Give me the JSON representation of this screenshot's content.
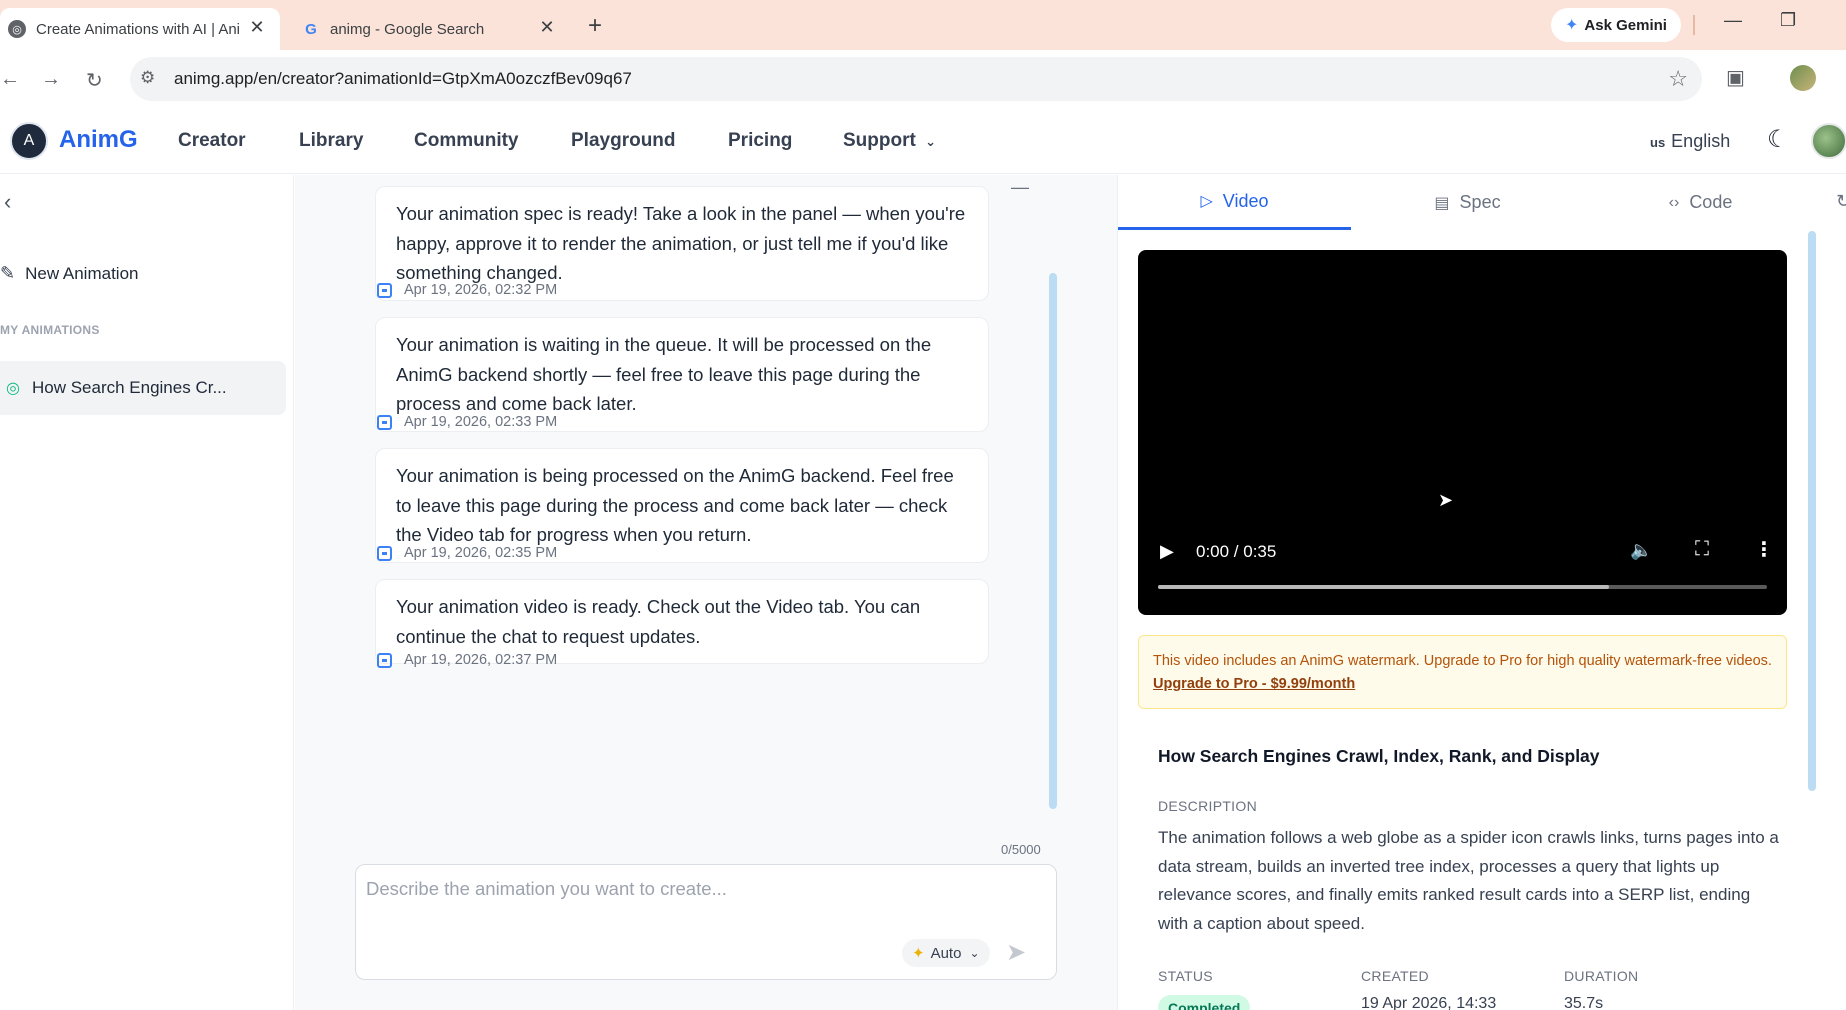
{
  "browser": {
    "tabs": [
      {
        "title": "Create Animations with AI | AnimG",
        "active": true
      },
      {
        "title": "animg - Google Search",
        "active": false
      }
    ],
    "ask_gemini": "Ask Gemini",
    "url": "animg.app/en/creator?animationId=GtpXmA0ozczfBev09q67"
  },
  "header": {
    "logo_letter": "A",
    "brand": "AnimG",
    "nav": [
      "Creator",
      "Library",
      "Community",
      "Playground",
      "Pricing",
      "Support"
    ],
    "lang_code": "us",
    "lang_label": "English"
  },
  "sidebar": {
    "new_animation": "New Animation",
    "section_label": "MY ANIMATIONS",
    "items": [
      {
        "label": "How Search Engines Cr...",
        "status": "completed"
      }
    ]
  },
  "chat": {
    "messages": [
      {
        "text": "Your animation spec is ready! Take a look in the panel — when you're happy, approve it to render the animation, or just tell me if you'd like something changed.",
        "time": "Apr 19, 2026, 02:32 PM"
      },
      {
        "text": "Your animation is waiting in the queue. It will be processed on the AnimG backend shortly — feel free to leave this page during the process and come back later.",
        "time": "Apr 19, 2026, 02:33 PM"
      },
      {
        "text": "Your animation is being processed on the AnimG backend. Feel free to leave this page during the process and come back later — check the Video tab for progress when you return.",
        "time": "Apr 19, 2026, 02:35 PM"
      },
      {
        "text": "Your animation video is ready. Check out the Video tab. You can continue the chat to request updates.",
        "time": "Apr 19, 2026, 02:37 PM"
      }
    ],
    "counter": "0/5000",
    "placeholder": "Describe the animation you want to create...",
    "mode": "Auto"
  },
  "panel": {
    "tabs": [
      "Video",
      "Spec",
      "Code"
    ],
    "active_tab": "Video",
    "video": {
      "time": "0:00 / 0:35",
      "buffered_fraction": 0.74
    },
    "watermark_text": "This video includes an AnimG watermark. Upgrade to Pro for high quality watermark-free videos.",
    "upgrade_link": "Upgrade to Pro - $9.99/month",
    "title": "How Search Engines Crawl, Index, Rank, and Display",
    "description_label": "DESCRIPTION",
    "description": "The animation follows a web globe as a spider icon crawls links, turns pages into a data stream, builds an inverted tree index, processes a query that lights up relevance scores, and finally emits ranked result cards into a SERP list, ending with a caption about speed.",
    "status_label": "STATUS",
    "status": "Completed",
    "created_label": "CREATED",
    "created": "19 Apr 2026, 14:33",
    "duration_label": "DURATION",
    "duration": "35.7s"
  },
  "colors": {
    "brand": "#2563eb",
    "tabstrip": "#fbe3d9",
    "success": "#10b981",
    "warning": "#b45309"
  }
}
